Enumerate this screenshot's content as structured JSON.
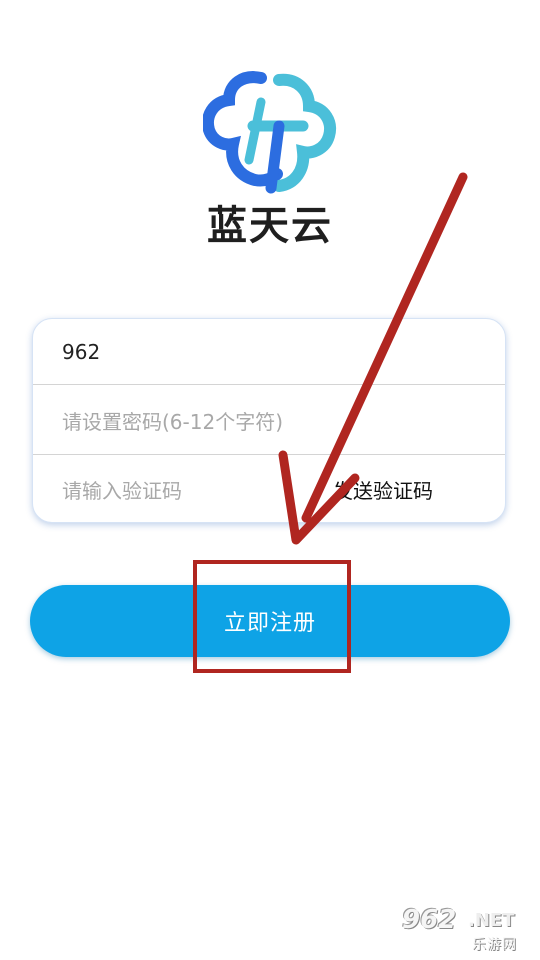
{
  "app": {
    "name": "蓝天云",
    "logo_icon": "blue-cloud-t-logo",
    "colors": {
      "logo_blue": "#2c6de0",
      "logo_cyan": "#4bbfd9",
      "button": "#0ea3e6",
      "annotation_red": "#b02620"
    }
  },
  "form": {
    "username_value": "962",
    "password_placeholder": "请设置密码(6-12个字符)",
    "code_placeholder": "请输入验证码",
    "send_code_label": "发送验证码"
  },
  "actions": {
    "register_label": "立即注册"
  },
  "watermark": {
    "site_number": "962",
    "site_suffix": ".NET",
    "site_name": "乐游网"
  }
}
